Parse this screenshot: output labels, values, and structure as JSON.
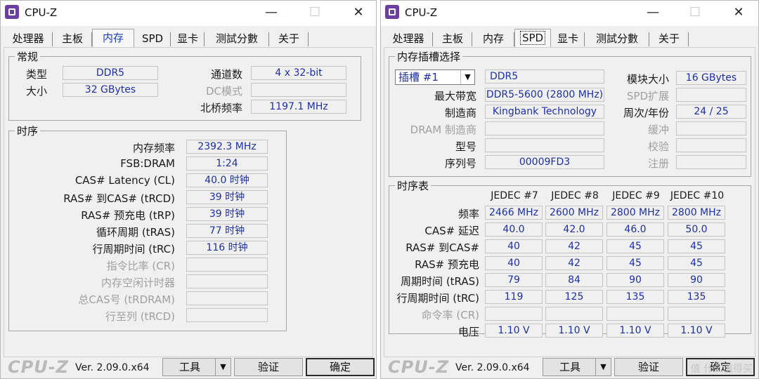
{
  "common": {
    "tabs": [
      "处理器",
      "主板",
      "内存",
      "SPD",
      "显卡",
      "测試分數",
      "关于"
    ],
    "brand": "CPU-Z",
    "version": "Ver. 2.09.0.x64",
    "tools_label": "工具",
    "validate_label": "验证",
    "ok_label": "确定",
    "title": "CPU-Z",
    "minimize": "—",
    "maximize": "☐",
    "close": "✕"
  },
  "memory": {
    "active_tab": "内存",
    "general": {
      "title": "常规",
      "type_label": "类型",
      "type": "DDR5",
      "size_label": "大小",
      "size": "32 GBytes",
      "channels_label": "通道数",
      "channels": "4 x 32-bit",
      "dc_mode_label": "DC模式",
      "dc_mode": "",
      "nb_freq_label": "北桥频率",
      "nb_freq": "1197.1 MHz"
    },
    "timings": {
      "title": "时序",
      "rows": [
        {
          "label": "内存频率",
          "value": "2392.3 MHz",
          "enabled": true
        },
        {
          "label": "FSB:DRAM",
          "value": "1:24",
          "enabled": true
        },
        {
          "label": "CAS# Latency (CL)",
          "value": "40.0 时钟",
          "enabled": true
        },
        {
          "label": "RAS# 到CAS# (tRCD)",
          "value": "39 时钟",
          "enabled": true
        },
        {
          "label": "RAS# 预充电 (tRP)",
          "value": "39 时钟",
          "enabled": true
        },
        {
          "label": "循环周期 (tRAS)",
          "value": "77 时钟",
          "enabled": true
        },
        {
          "label": "行周期时间 (tRC)",
          "value": "116 时钟",
          "enabled": true
        },
        {
          "label": "指令比率 (CR)",
          "value": "",
          "enabled": false
        },
        {
          "label": "内存空闲计时器",
          "value": "",
          "enabled": false
        },
        {
          "label": "总CAS号 (tRDRAM)",
          "value": "",
          "enabled": false
        },
        {
          "label": "行至列 (tRCD)",
          "value": "",
          "enabled": false
        }
      ]
    }
  },
  "spd": {
    "active_tab": "SPD",
    "slot_group_title": "内存插槽选择",
    "slot_select": "插槽 #1",
    "module_type": "DDR5",
    "left_rows": [
      {
        "label": "最大带宽",
        "value": "DDR5-5600 (2800 MHz)",
        "enabled": true
      },
      {
        "label": "制造商",
        "value": "Kingbank Technology",
        "enabled": true
      },
      {
        "label": "DRAM 制造商",
        "value": "",
        "enabled": false
      },
      {
        "label": "型号",
        "value": "",
        "enabled": true
      },
      {
        "label": "序列号",
        "value": "00009FD3",
        "enabled": true
      }
    ],
    "right_rows": [
      {
        "label": "模块大小",
        "value": "16 GBytes",
        "enabled": true
      },
      {
        "label": "SPD扩展",
        "value": "",
        "enabled": false
      },
      {
        "label": "周次/年份",
        "value": "24 / 25",
        "enabled": true
      },
      {
        "label": "缓冲",
        "value": "",
        "enabled": false
      },
      {
        "label": "校验",
        "value": "",
        "enabled": false
      },
      {
        "label": "注册",
        "value": "",
        "enabled": false
      }
    ],
    "timing_table": {
      "title": "时序表",
      "columns": [
        "JEDEC #7",
        "JEDEC #8",
        "JEDEC #9",
        "JEDEC #10"
      ],
      "rows": [
        {
          "label": "频率",
          "enabled": true,
          "values": [
            "2466 MHz",
            "2600 MHz",
            "2800 MHz",
            "2800 MHz"
          ]
        },
        {
          "label": "CAS# 延迟",
          "enabled": true,
          "values": [
            "40.0",
            "42.0",
            "46.0",
            "50.0"
          ]
        },
        {
          "label": "RAS# 到CAS#",
          "enabled": true,
          "values": [
            "40",
            "42",
            "45",
            "45"
          ]
        },
        {
          "label": "RAS# 预充电",
          "enabled": true,
          "values": [
            "40",
            "42",
            "45",
            "45"
          ]
        },
        {
          "label": "周期时间 (tRAS)",
          "enabled": true,
          "values": [
            "79",
            "84",
            "90",
            "90"
          ]
        },
        {
          "label": "行周期时间 (tRC)",
          "enabled": true,
          "values": [
            "119",
            "125",
            "135",
            "135"
          ]
        },
        {
          "label": "命令率 (CR)",
          "enabled": false,
          "values": [
            "",
            "",
            "",
            ""
          ]
        },
        {
          "label": "电压",
          "enabled": true,
          "values": [
            "1.10 V",
            "1.10 V",
            "1.10 V",
            "1.10 V"
          ]
        }
      ]
    },
    "watermark": "值 什么值得买"
  }
}
